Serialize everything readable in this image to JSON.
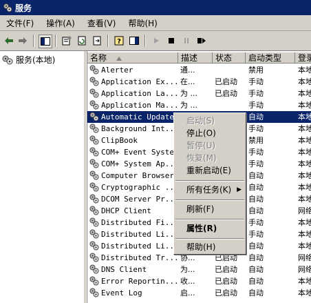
{
  "window": {
    "title": "服务"
  },
  "menu": [
    "文件(F)",
    "操作(A)",
    "查看(V)",
    "帮助(H)"
  ],
  "tree": {
    "root_label": "服务(本地)"
  },
  "table": {
    "columns": [
      "名称",
      "描述",
      "状态",
      "启动类型",
      "登录"
    ],
    "rows": [
      {
        "name": "Alerter",
        "desc": "通...",
        "status": "",
        "type": "禁用",
        "login": "本地"
      },
      {
        "name": "Application Ex...",
        "desc": "在...",
        "status": "已启动",
        "type": "手动",
        "login": "本地"
      },
      {
        "name": "Application La...",
        "desc": "为 ...",
        "status": "已启动",
        "type": "手动",
        "login": "本地"
      },
      {
        "name": "Application Ma...",
        "desc": "为 ...",
        "status": "",
        "type": "手动",
        "login": "本地"
      },
      {
        "name": "Automatic Updates",
        "desc": "",
        "status": "",
        "type": "自动",
        "login": "本地"
      },
      {
        "name": "Background Int...",
        "desc": "",
        "status": "",
        "type": "手动",
        "login": "本地"
      },
      {
        "name": "ClipBook",
        "desc": "",
        "status": "",
        "type": "禁用",
        "login": "本地"
      },
      {
        "name": "COM+ Event System",
        "desc": "",
        "status": "",
        "type": "手动",
        "login": "本地"
      },
      {
        "name": "COM+ System Ap...",
        "desc": "",
        "status": "",
        "type": "手动",
        "login": "本地"
      },
      {
        "name": "Computer Browser",
        "desc": "",
        "status": "",
        "type": "自动",
        "login": "本地"
      },
      {
        "name": "Cryptographic ...",
        "desc": "",
        "status": "",
        "type": "自动",
        "login": "本地"
      },
      {
        "name": "DCOM Server Pr...",
        "desc": "",
        "status": "",
        "type": "自动",
        "login": "本地"
      },
      {
        "name": "DHCP Client",
        "desc": "",
        "status": "",
        "type": "自动",
        "login": "网络"
      },
      {
        "name": "Distributed Fi...",
        "desc": "",
        "status": "",
        "type": "手动",
        "login": "本地"
      },
      {
        "name": "Distributed Li...",
        "desc": "",
        "status": "",
        "type": "手动",
        "login": "本地"
      },
      {
        "name": "Distributed Li...",
        "desc": "",
        "status": "",
        "type": "自动",
        "login": "本地"
      },
      {
        "name": "Distributed Tr...",
        "desc": "协...",
        "status": "已启动",
        "type": "自动",
        "login": "网络"
      },
      {
        "name": "DNS Client",
        "desc": "为...",
        "status": "已启动",
        "type": "自动",
        "login": "网络"
      },
      {
        "name": "Error Reportin...",
        "desc": "收...",
        "status": "已启动",
        "type": "自动",
        "login": "本地"
      },
      {
        "name": "Event Log",
        "desc": "启...",
        "status": "已启动",
        "type": "自动",
        "login": "本地"
      }
    ]
  },
  "context_menu": {
    "start": "启动(S)",
    "stop": "停止(O)",
    "pause": "暂停(U)",
    "resume": "恢复(M)",
    "restart": "重新启动(E)",
    "all_tasks": "所有任务(K)",
    "refresh": "刷新(F)",
    "properties": "属性(R)",
    "help": "帮助(H)"
  },
  "colors": {
    "selection": "#0a246a",
    "chrome": "#d4d0c8"
  }
}
